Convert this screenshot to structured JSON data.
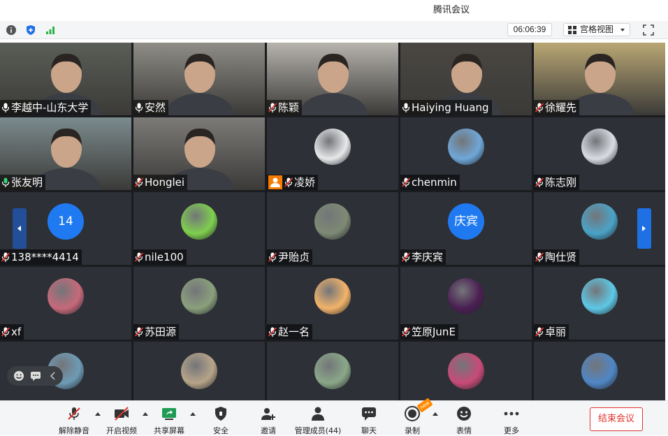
{
  "app": {
    "title": "腾讯会议"
  },
  "infobar": {
    "timer": "06:06:39",
    "view_label": "宫格视图"
  },
  "participants": [
    {
      "name": "李越中-山东大学",
      "mic": "on",
      "kind": "video",
      "bg": "#5a5e57"
    },
    {
      "name": "安然",
      "mic": "on",
      "kind": "video",
      "bg": "#8f8d86"
    },
    {
      "name": "陈颖",
      "mic": "muted",
      "kind": "video",
      "bg": "#b7b4ae"
    },
    {
      "name": "Haiying Huang",
      "mic": "on",
      "kind": "video",
      "bg": "#4a4742"
    },
    {
      "name": "徐耀先",
      "mic": "muted",
      "kind": "video",
      "bg": "#b9a774"
    },
    {
      "name": "张友明",
      "mic": "speaking",
      "kind": "video",
      "bg": "#7b8b8d"
    },
    {
      "name": "Honglei",
      "mic": "muted",
      "kind": "video",
      "bg": "#7d7b78"
    },
    {
      "name": "凌娇",
      "mic": "muted",
      "kind": "avatar",
      "avatar_color": "#e7e8ea",
      "host": true
    },
    {
      "name": "chenmin",
      "mic": "muted",
      "kind": "avatar",
      "avatar_color": "#6fa7d8"
    },
    {
      "name": "陈志刚",
      "mic": "muted",
      "kind": "avatar",
      "avatar_color": "#d9dde3"
    },
    {
      "name": "138****4414",
      "mic": "muted",
      "kind": "text",
      "avatar_text": "14"
    },
    {
      "name": "nile100",
      "mic": "muted",
      "kind": "avatar",
      "avatar_color": "#7ecf4e"
    },
    {
      "name": "尹贻贞",
      "mic": "muted",
      "kind": "avatar",
      "avatar_color": "#7d8a74"
    },
    {
      "name": "李庆宾",
      "mic": "muted",
      "kind": "text",
      "avatar_text": "庆宾"
    },
    {
      "name": "陶仕贤",
      "mic": "muted",
      "kind": "avatar",
      "avatar_color": "#4aa3c7"
    },
    {
      "name": "xf",
      "mic": "muted",
      "kind": "avatar",
      "avatar_color": "#c7697a"
    },
    {
      "name": "苏田源",
      "mic": "muted",
      "kind": "avatar",
      "avatar_color": "#8aa07c"
    },
    {
      "name": "赵一名",
      "mic": "muted",
      "kind": "avatar",
      "avatar_color": "#f2b36a"
    },
    {
      "name": "笠原JunE",
      "mic": "muted",
      "kind": "avatar",
      "avatar_color": "#4a1f52"
    },
    {
      "name": "卓丽",
      "mic": "muted",
      "kind": "avatar",
      "avatar_color": "#5ec8e6"
    },
    {
      "name": "",
      "mic": "",
      "kind": "avatar",
      "avatar_color": "#6e9bb5"
    },
    {
      "name": "",
      "mic": "",
      "kind": "avatar",
      "avatar_color": "#b7a489"
    },
    {
      "name": "",
      "mic": "",
      "kind": "avatar",
      "avatar_color": "#8aa888"
    },
    {
      "name": "",
      "mic": "",
      "kind": "avatar",
      "avatar_color": "#c84a76"
    },
    {
      "name": "",
      "mic": "",
      "kind": "avatar",
      "avatar_color": "#4f86c6"
    }
  ],
  "toolbar": {
    "unmute": "解除静音",
    "start_video": "开启视频",
    "share_screen": "共享屏幕",
    "security": "安全",
    "invite": "邀请",
    "manage_members": "管理成员(44)",
    "chat": "聊天",
    "record": "录制",
    "reactions": "表情",
    "more": "更多",
    "end_meeting": "结束会议",
    "record_badge": "new"
  },
  "colors": {
    "accent": "#1f6fe5",
    "end_red": "#e0332e",
    "muted_red": "#e0332e",
    "active_green": "#2ed573"
  }
}
